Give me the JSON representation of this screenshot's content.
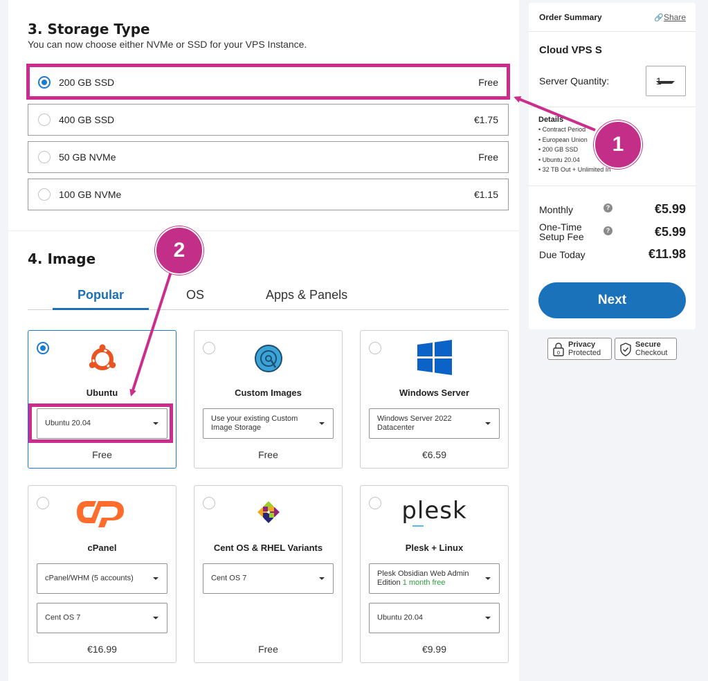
{
  "storage": {
    "title": "3. Storage Type",
    "subtitle": "You can now choose either NVMe or SSD for your VPS Instance.",
    "options": [
      {
        "label": "200 GB SSD",
        "price": "Free"
      },
      {
        "label": "400 GB SSD",
        "price": "€1.75"
      },
      {
        "label": "50 GB NVMe",
        "price": "Free"
      },
      {
        "label": "100 GB NVMe",
        "price": "€1.15"
      }
    ],
    "selected_index": 0
  },
  "image": {
    "title": "4. Image",
    "tabs": [
      "Popular",
      "OS",
      "Apps & Panels"
    ],
    "active_tab": "Popular",
    "cards": [
      {
        "name": "Ubuntu",
        "select": "Ubuntu 20.04",
        "price": "Free",
        "icon": "ubuntu-logo-icon",
        "selected": true
      },
      {
        "name": "Custom Images",
        "select": "Use your existing Custom Image Storage",
        "price": "Free",
        "icon": "custom-images-icon"
      },
      {
        "name": "Windows Server",
        "select": "Windows Server 2022 Datacenter",
        "price": "€6.59",
        "icon": "windows-logo-icon"
      },
      {
        "name": "cPanel",
        "select": "cPanel/WHM (5 accounts)",
        "select2": "Cent OS 7",
        "price": "€16.99",
        "icon": "cpanel-logo-icon"
      },
      {
        "name": "Cent OS & RHEL Variants",
        "select": "Cent OS 7",
        "price": "Free",
        "icon": "centos-logo-icon"
      },
      {
        "name": "Plesk + Linux",
        "select": "Plesk Obsidian Web Admin Edition",
        "select_note": "1 month free",
        "select2": "Ubuntu 20.04",
        "price": "€9.99",
        "icon": "plesk-logo-icon",
        "logo_text": "plesk"
      }
    ]
  },
  "summary": {
    "title": "Order Summary",
    "share": "Share",
    "product": "Cloud VPS S",
    "quantity_label": "Server Quantity:",
    "quantity": "1",
    "details_title": "Details",
    "details": [
      "Contract Period",
      "European Union",
      "200 GB SSD",
      "Ubuntu 20.04",
      "32 TB Out + Unlimited In"
    ],
    "monthly_label": "Monthly",
    "monthly": "€5.99",
    "setup_label_1": "One-Time",
    "setup_label_2": "Setup Fee",
    "setup": "€5.99",
    "due_label": "Due Today",
    "due": "€11.98",
    "next": "Next"
  },
  "badges": {
    "privacy_1": "Privacy",
    "privacy_2": "Protected",
    "secure_1": "Secure",
    "secure_2": "Checkout"
  },
  "annotations": {
    "callout_1": "1",
    "callout_2": "2",
    "color": "#cc2d8c"
  },
  "colors": {
    "accent": "#1a72bb",
    "highlight": "#cc2d8c"
  }
}
